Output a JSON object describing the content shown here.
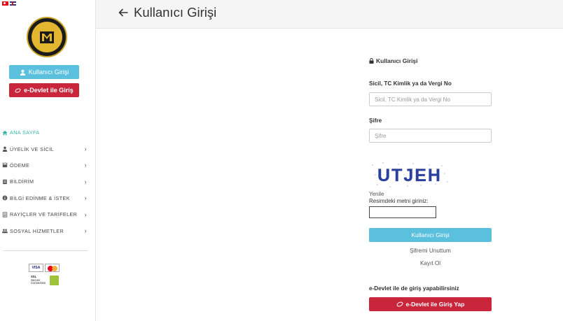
{
  "header": {
    "title": "Kullanıcı Girişi"
  },
  "sidebar": {
    "logo_text": "YENİMAHALLE BELEDİYESİ 1984",
    "login_button": "Kullanıcı Girişi",
    "edevlet_button": "e-Devlet ile Giriş",
    "menu": [
      {
        "label": "ANA SAYFA",
        "icon": "home-icon"
      },
      {
        "label": "ÜYELİK VE SİCİL",
        "icon": "user-icon"
      },
      {
        "label": "ÖDEME",
        "icon": "calculator-icon"
      },
      {
        "label": "BİLDİRİM",
        "icon": "document-icon"
      },
      {
        "label": "BİLGİ EDİNME & İSTEK",
        "icon": "info-icon"
      },
      {
        "label": "RAYİÇLER VE TARİFELER",
        "icon": "list-icon"
      },
      {
        "label": "SOSYAL HİZMETLER",
        "icon": "users-icon"
      }
    ],
    "payment": {
      "visa": "VISA",
      "ssl": [
        "SSL",
        "Secure",
        "Connection"
      ]
    }
  },
  "form": {
    "title": "Kullanıcı Girişi",
    "id_label": "Sicil, TC Kimlik ya da Vergi No",
    "id_placeholder": "Sicil, TC Kimlik ya da Vergi No",
    "password_label": "Şifre",
    "password_placeholder": "Şifre",
    "captcha_text": "UTJEH",
    "refresh": "Yenile",
    "captcha_label": "Resimdeki metni giriniz:",
    "submit": "Kullanıcı Girişi",
    "forgot": "Şifremi Unuttum",
    "register": "Kayıt Ol",
    "edevlet_title": "e-Devlet ile de giriş yapabilirsiniz",
    "edevlet_button": "e-Devlet ile Giriş Yap"
  },
  "colors": {
    "accent": "#5bc0de",
    "edevlet": "#c9263c",
    "active_menu": "#37b5a4"
  }
}
